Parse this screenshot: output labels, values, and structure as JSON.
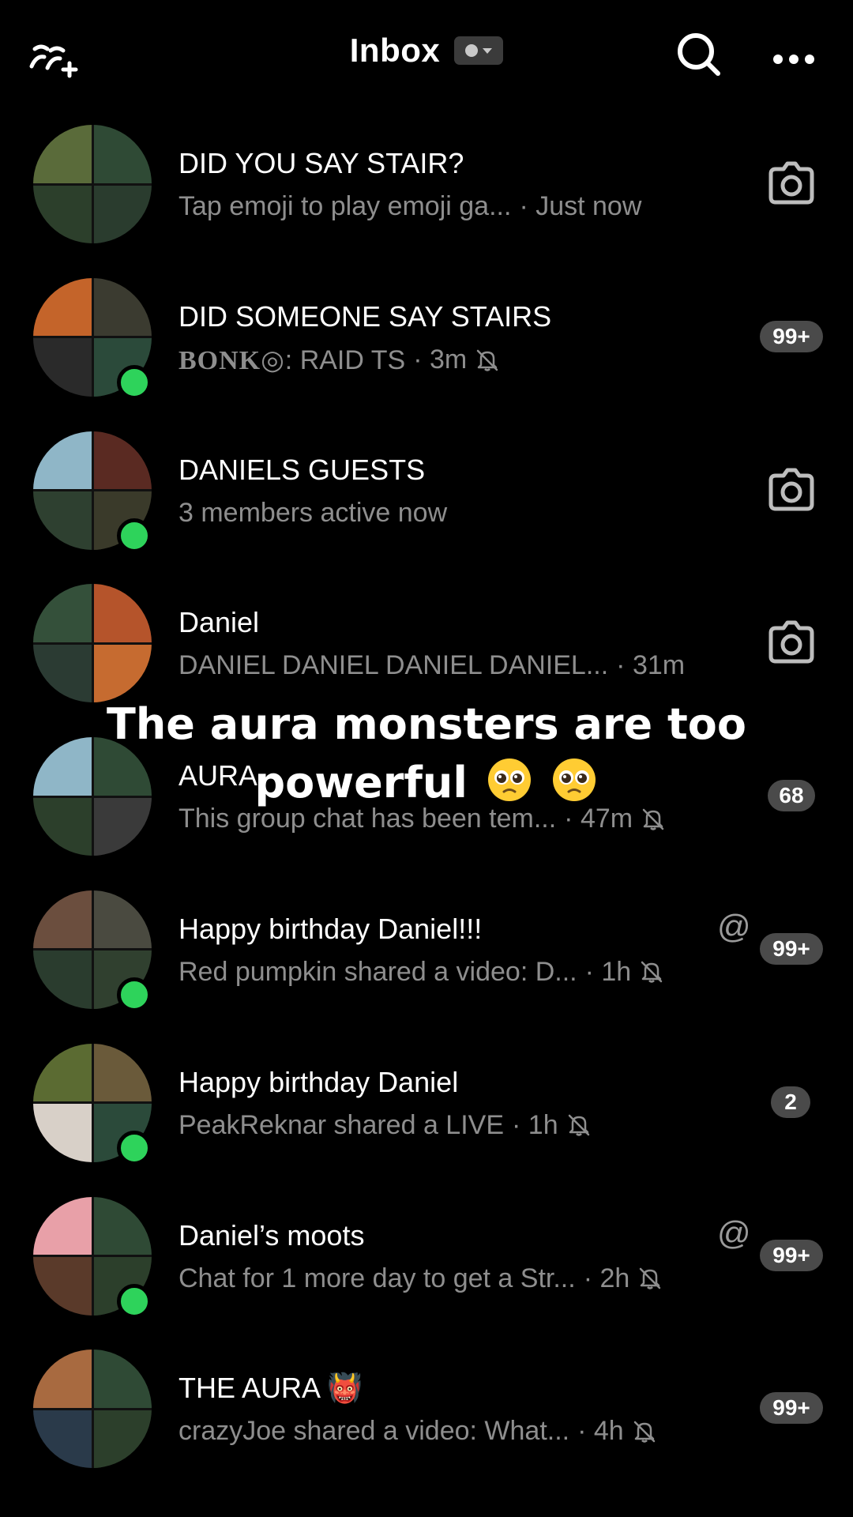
{
  "header": {
    "title": "Inbox",
    "add_icon": "add-friends-icon",
    "search_icon": "search-icon",
    "more_icon": "more-dots-icon",
    "status_icon": "status-dot-icon"
  },
  "colors": {
    "background": "#000000",
    "text_primary": "#ffffff",
    "text_secondary": "#8e8e8e",
    "online": "#2ed35b",
    "badge": "#4a4a4a"
  },
  "chats": [
    {
      "title": "DID YOU SAY STAIR?",
      "subtitle": "Tap emoji to play emoji ga...",
      "time": "· Just now",
      "online": false,
      "muted": false,
      "action": "camera",
      "badge": "",
      "mention": false,
      "avatar_colors": [
        "#5a6b3a",
        "#2f4a35",
        "#2c3f2b",
        "#2a3c2e"
      ]
    },
    {
      "title": "DID SOMEONE SAY STAIRS",
      "subtitle_prefix": "BONK◎",
      "subtitle": ": RAID TS",
      "time": "· 3m",
      "online": true,
      "muted": true,
      "action": "badge",
      "badge": "99+",
      "mention": false,
      "avatar_colors": [
        "#c4642a",
        "#3b3b30",
        "#2a2a2a",
        "#2b4a3a"
      ]
    },
    {
      "title": "DANIELS GUESTS",
      "subtitle": "3 members active now",
      "time": "",
      "online": true,
      "muted": false,
      "action": "camera",
      "badge": "",
      "mention": false,
      "avatar_colors": [
        "#8fb6c7",
        "#5a2a22",
        "#2e4030",
        "#3a3a2a"
      ]
    },
    {
      "title": "Daniel",
      "subtitle": "DANIEL DANIEL DANIEL DANIEL...",
      "time": "· 31m",
      "online": false,
      "muted": false,
      "action": "camera",
      "badge": "",
      "mention": false,
      "avatar_colors": [
        "#34503a",
        "#b5542b",
        "#2b3b33",
        "#c66b30"
      ]
    },
    {
      "title": "AURA",
      "subtitle": "This group chat has been tem...",
      "time": "· 47m",
      "online": false,
      "muted": true,
      "action": "badge",
      "badge": "68",
      "mention": false,
      "avatar_colors": [
        "#8fb6c7",
        "#2f4a35",
        "#2c3f2b",
        "#3a3a3a"
      ]
    },
    {
      "title": "Happy birthday Daniel!!!",
      "subtitle": "Red pumpkin shared a video: D...",
      "time": "· 1h",
      "online": true,
      "muted": true,
      "action": "badge",
      "badge": "99+",
      "mention": true,
      "avatar_colors": [
        "#6b4e3e",
        "#4a4a40",
        "#2a3c2e",
        "#30402f"
      ]
    },
    {
      "title": "Happy birthday Daniel",
      "subtitle": "PeakReknar shared a LIVE",
      "time": "· 1h",
      "online": true,
      "muted": true,
      "action": "badge",
      "badge": "2",
      "mention": false,
      "avatar_colors": [
        "#5b6b32",
        "#6a5a3a",
        "#d8d0c8",
        "#2b4a3a"
      ]
    },
    {
      "title": "Daniel’s moots",
      "subtitle": "Chat for 1 more day to get a Str...",
      "time": "· 2h",
      "online": true,
      "muted": true,
      "action": "badge",
      "badge": "99+",
      "mention": true,
      "avatar_colors": [
        "#e8a0a8",
        "#2f4a35",
        "#5a3a2a",
        "#2c3f2b"
      ]
    },
    {
      "title": "THE AURA 👹",
      "subtitle": "crazyJoe shared a video: What...",
      "time": "· 4h",
      "online": false,
      "muted": true,
      "action": "badge",
      "badge": "99+",
      "mention": false,
      "avatar_colors": [
        "#a86a40",
        "#2f4a35",
        "#2a3a4a",
        "#2c3f2b"
      ]
    }
  ],
  "overlay_caption": {
    "line1": "The aura monsters are too",
    "line2": "powerful",
    "emoji": "pleading-face-emoji"
  }
}
